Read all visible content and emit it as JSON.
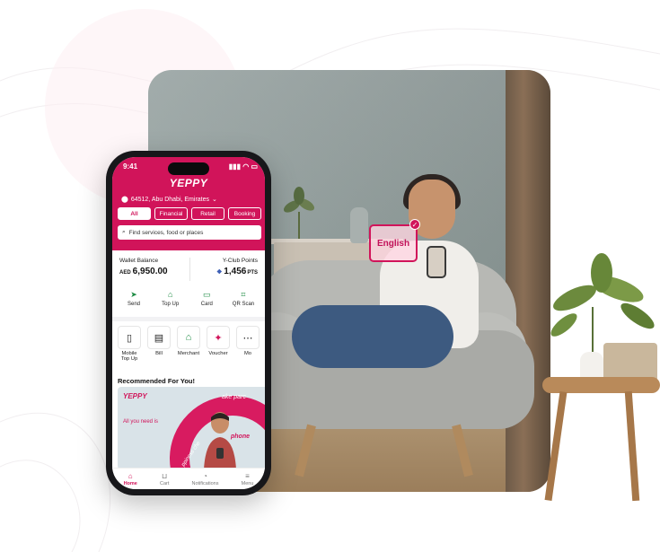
{
  "overlay": {
    "language_tag": "English"
  },
  "phone": {
    "status": {
      "time": "9:41"
    },
    "app": {
      "logo": "YEPPY",
      "location": "64512, Abu Dhabi, Emirates",
      "tabs": [
        {
          "label": "All",
          "active": true
        },
        {
          "label": "Financial",
          "active": false
        },
        {
          "label": "Retail",
          "active": false
        },
        {
          "label": "Booking",
          "active": false
        }
      ],
      "search_placeholder": "Find services, food or places",
      "wallet": {
        "label": "Wallet Balance",
        "currency": "AED",
        "amount": "6,950.00",
        "points_label": "Y-Club Points",
        "points": "1,456",
        "points_unit": "PTS"
      },
      "quick_actions": [
        {
          "label": "Send",
          "icon": "send-icon"
        },
        {
          "label": "Top Up",
          "icon": "top-up-icon"
        },
        {
          "label": "Card",
          "icon": "card-icon"
        },
        {
          "label": "QR Scan",
          "icon": "qr-scan-icon"
        }
      ],
      "services": [
        {
          "label": "Mobile Top Up",
          "icon": "mobile-icon"
        },
        {
          "label": "Bill",
          "icon": "bill-icon"
        },
        {
          "label": "Merchant",
          "icon": "merchant-icon"
        },
        {
          "label": "Voucher",
          "icon": "voucher-icon"
        },
        {
          "label": "Mo",
          "icon": "more-icon"
        }
      ],
      "recommended_title": "Recommended For You!",
      "banner": {
        "logo": "YEPPY",
        "text": "All you need is",
        "arc_top": "ake parc",
        "arc_right": "phone",
        "arc_left": "ppiness che"
      },
      "bottom_nav": [
        {
          "label": "Home",
          "icon": "home-icon",
          "active": true
        },
        {
          "label": "Cart",
          "icon": "cart-icon",
          "active": false
        },
        {
          "label": "Notifications",
          "icon": "bell-icon",
          "active": false
        },
        {
          "label": "Menu",
          "icon": "menu-icon",
          "active": false
        }
      ]
    }
  },
  "colors": {
    "brand": "#d1145a",
    "accent_green": "#1d8b43"
  }
}
